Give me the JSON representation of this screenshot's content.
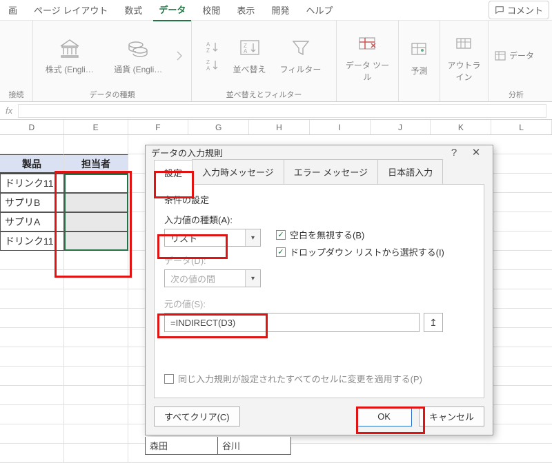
{
  "ribbon": {
    "tabs": [
      "画",
      "ページ レイアウト",
      "数式",
      "データ",
      "校閲",
      "表示",
      "開発",
      "ヘルプ"
    ],
    "comment_btn": "コメント",
    "groups": {
      "connect": "接続",
      "data_types": "データの種類",
      "sort_filter": "並べ替えとフィルター",
      "analyze": "分析",
      "b1": "株式 (Engli…",
      "b2": "通貨 (Engli…",
      "b3": "並べ替え",
      "b4": "フィルター",
      "b5": "データ ツール",
      "b6": "予測",
      "b7": "アウトラ\nイン",
      "b8": "データ"
    }
  },
  "fx": {
    "label": "fx",
    "value": ""
  },
  "cols": [
    "D",
    "E",
    "F",
    "G",
    "H",
    "I",
    "J",
    "K",
    "L"
  ],
  "sheet": {
    "h1": "製品",
    "h2": "担当者",
    "rows": [
      "ドリンク11",
      "サプリB",
      "サプリA",
      "ドリンク11"
    ]
  },
  "dialog": {
    "title": "データの入力規則",
    "tabs": [
      "設定",
      "入力時メッセージ",
      "エラー メッセージ",
      "日本語入力"
    ],
    "section": "条件の設定",
    "type_label": "入力値の種類(A):",
    "type_value": "リスト",
    "data_label": "データ(D):",
    "data_value": "次の値の間",
    "source_label": "元の値(S):",
    "source_value": "=INDIRECT(D3)",
    "cb1": "空白を無視する(B)",
    "cb2": "ドロップダウン リストから選択する(I)",
    "apply_all": "同じ入力規則が設定されたすべてのセルに変更を適用する(P)",
    "clear": "すべてクリア(C)",
    "ok": "OK",
    "cancel": "キャンセル"
  },
  "names": {
    "r2c1": "森田",
    "r2c2": "谷川"
  }
}
